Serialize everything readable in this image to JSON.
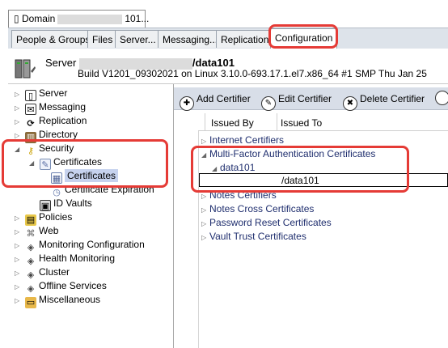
{
  "window_tab": {
    "prefix": "Domain",
    "suffix": "101..."
  },
  "tabs": [
    {
      "label": "People & Groups"
    },
    {
      "label": "Files"
    },
    {
      "label": "Server..."
    },
    {
      "label": "Messaging..."
    },
    {
      "label": "Replication"
    },
    {
      "label": "Configuration",
      "active": true
    }
  ],
  "header": {
    "server_prefix": "Server",
    "server_suffix": "/data101",
    "build": "Build V1201_09302021 on Linux 3.10.0-693.17.1.el7.x86_64 #1 SMP Thu Jan 25"
  },
  "tree": [
    {
      "label": "Server",
      "icon": "server-icon"
    },
    {
      "label": "Messaging",
      "icon": "messaging-icon"
    },
    {
      "label": "Replication",
      "icon": "replication-icon"
    },
    {
      "label": "Directory",
      "icon": "directory-icon"
    },
    {
      "label": "Security",
      "icon": "key-icon"
    },
    {
      "label": "Certificates",
      "icon": "certificate-icon"
    },
    {
      "label": "Certificates",
      "icon": "certificate-table-icon",
      "selected": true
    },
    {
      "label": "Certificate Expiration",
      "icon": "expiration-icon"
    },
    {
      "label": "ID Vaults",
      "icon": "vault-icon"
    },
    {
      "label": "Policies",
      "icon": "policies-icon"
    },
    {
      "label": "Web",
      "icon": "web-icon"
    },
    {
      "label": "Monitoring Configuration",
      "icon": "monitoring-icon"
    },
    {
      "label": "Health Monitoring",
      "icon": "health-icon"
    },
    {
      "label": "Cluster",
      "icon": "cluster-icon"
    },
    {
      "label": "Offline Services",
      "icon": "offline-icon"
    },
    {
      "label": "Miscellaneous",
      "icon": "folder-icon"
    }
  ],
  "toolbar": {
    "add_certifier": "Add Certifier",
    "edit_certifier": "Edit Certifier",
    "delete_certifier": "Delete Certifier"
  },
  "columns": {
    "issued_by": "Issued By",
    "issued_to": "Issued To"
  },
  "rows": [
    {
      "label": "Internet Certifiers"
    },
    {
      "label": "Multi-Factor Authentication Certificates"
    },
    {
      "label": "data101"
    },
    {
      "label": "/data101"
    },
    {
      "label": "Notes Certifiers"
    },
    {
      "label": "Notes Cross Certificates"
    },
    {
      "label": "Password Reset Certificates"
    },
    {
      "label": "Vault Trust Certificates"
    }
  ],
  "colors": {
    "highlight": "#e53b36",
    "tree_selected": "#c6d2ee",
    "toolbar_bg": "#d8dee8",
    "link_text": "#1f2e6e"
  }
}
